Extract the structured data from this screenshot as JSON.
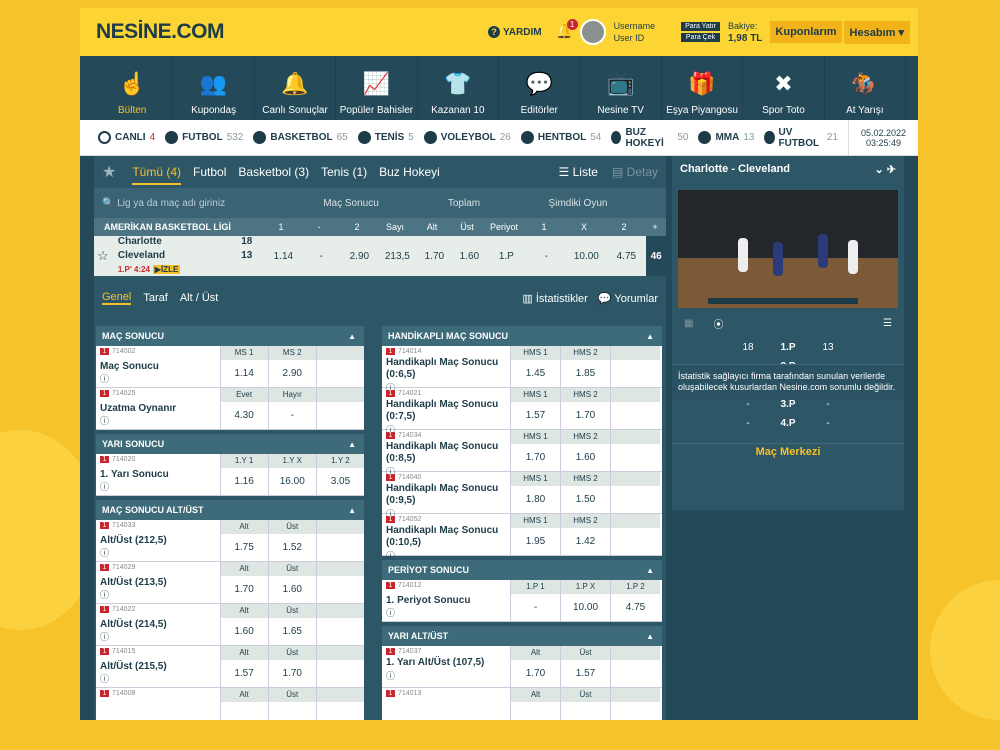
{
  "header": {
    "logo": "NESİNE.COM",
    "help": "YARDIM",
    "notif_count": "1",
    "username": "Username",
    "user_id": "User ID",
    "deposit": "Para Yatır",
    "withdraw": "Para Çek",
    "balance_label": "Bakiye:",
    "balance": "1,98 TL",
    "coupons": "Kuponlarım",
    "account": "Hesabım"
  },
  "nav": [
    "Bülten",
    "Kupondaş",
    "Canlı Sonuçlar",
    "Popüler Bahisler",
    "Kazanan 10",
    "Editörler",
    "Nesine TV",
    "Eşya Piyangosu",
    "Spor Toto",
    "At Yarışı"
  ],
  "sports": [
    {
      "label": "CANLI",
      "count": "4"
    },
    {
      "label": "FUTBOL",
      "count": "532"
    },
    {
      "label": "BASKETBOL",
      "count": "65"
    },
    {
      "label": "TENİS",
      "count": "5"
    },
    {
      "label": "VOLEYBOL",
      "count": "26"
    },
    {
      "label": "HENTBOL",
      "count": "54"
    },
    {
      "label": "BUZ HOKEYİ",
      "count": "50"
    },
    {
      "label": "MMA",
      "count": "13"
    },
    {
      "label": "UV FUTBOL",
      "count": "21"
    }
  ],
  "date": "05.02.2022",
  "time": "03:25:49",
  "filters": [
    "Tümü (4)",
    "Futbol",
    "Basketbol (3)",
    "Tenis (1)",
    "Buz Hokeyi"
  ],
  "view": {
    "list": "Liste",
    "detail": "Detay"
  },
  "search_placeholder": "Lig ya da maç adı giriniz",
  "col_groups": [
    "Maç Sonucu",
    "Toplam",
    "Şimdiki Oyun"
  ],
  "league": "AMERİKAN BASKETBOL LİGİ",
  "league_cols": [
    "1",
    "-",
    "2",
    "Sayı",
    "Alt",
    "Üst",
    "Periyot",
    "1",
    "X",
    "2",
    "+"
  ],
  "match": {
    "home": "Charlotte",
    "away": "Cleveland",
    "hs": "18",
    "as": "13",
    "live": "1.P' 4:24",
    "watch": "İZLE",
    "odds": [
      "1.14",
      "-",
      "2.90",
      "213,5",
      "1.70",
      "1.60",
      "1.P",
      "-",
      "10.00",
      "4.75"
    ],
    "more": "46"
  },
  "subtabs": [
    "Genel",
    "Taraf",
    "Alt / Üst"
  ],
  "stats": "İstatistikler",
  "comments": "Yorumlar",
  "left_markets": [
    {
      "title": "MAÇ SONUCU",
      "rows": [
        {
          "code": "714002",
          "name": "Maç Sonucu",
          "h": [
            "MS 1",
            "MS 2",
            ""
          ],
          "v": [
            "1.14",
            "2.90",
            ""
          ]
        },
        {
          "code": "714025",
          "name": "Uzatma Oynanır",
          "h": [
            "Evet",
            "Hayır",
            ""
          ],
          "v": [
            "4.30",
            "-",
            ""
          ]
        }
      ]
    },
    {
      "title": "YARI SONUCU",
      "rows": [
        {
          "code": "714020",
          "name": "1. Yarı Sonucu",
          "h": [
            "1.Y 1",
            "1.Y X",
            "1.Y 2"
          ],
          "v": [
            "1.16",
            "16.00",
            "3.05"
          ]
        }
      ]
    },
    {
      "title": "MAÇ SONUCU ALT/ÜST",
      "rows": [
        {
          "code": "714033",
          "name": "Alt/Üst (212,5)",
          "h": [
            "Alt",
            "Üst",
            ""
          ],
          "v": [
            "1.75",
            "1.52",
            ""
          ]
        },
        {
          "code": "714029",
          "name": "Alt/Üst (213,5)",
          "h": [
            "Alt",
            "Üst",
            ""
          ],
          "v": [
            "1.70",
            "1.60",
            ""
          ]
        },
        {
          "code": "714022",
          "name": "Alt/Üst (214,5)",
          "h": [
            "Alt",
            "Üst",
            ""
          ],
          "v": [
            "1.60",
            "1.65",
            ""
          ]
        },
        {
          "code": "714015",
          "name": "Alt/Üst (215,5)",
          "h": [
            "Alt",
            "Üst",
            ""
          ],
          "v": [
            "1.57",
            "1.70",
            ""
          ]
        },
        {
          "code": "714008",
          "name": "",
          "h": [
            "Alt",
            "Üst",
            ""
          ],
          "v": [
            "",
            "",
            ""
          ]
        }
      ]
    }
  ],
  "right_markets": [
    {
      "title": "HANDİKAPLI MAÇ SONUCU",
      "rows": [
        {
          "code": "714014",
          "name": "Handikaplı Maç Sonucu (0:6,5)",
          "h": [
            "HMS 1",
            "HMS 2",
            ""
          ],
          "v": [
            "1.45",
            "1.85",
            ""
          ]
        },
        {
          "code": "714021",
          "name": "Handikaplı Maç Sonucu (0:7,5)",
          "h": [
            "HMS 1",
            "HMS 2",
            ""
          ],
          "v": [
            "1.57",
            "1.70",
            ""
          ]
        },
        {
          "code": "714034",
          "name": "Handikaplı Maç Sonucu (0:8,5)",
          "h": [
            "HMS 1",
            "HMS 2",
            ""
          ],
          "v": [
            "1.70",
            "1.60",
            ""
          ]
        },
        {
          "code": "714040",
          "name": "Handikaplı Maç Sonucu (0:9,5)",
          "h": [
            "HMS 1",
            "HMS 2",
            ""
          ],
          "v": [
            "1.80",
            "1.50",
            ""
          ]
        },
        {
          "code": "714052",
          "name": "Handikaplı Maç Sonucu (0:10,5)",
          "h": [
            "HMS 1",
            "HMS 2",
            ""
          ],
          "v": [
            "1.95",
            "1.42",
            ""
          ]
        }
      ]
    },
    {
      "title": "PERİYOT SONUCU",
      "rows": [
        {
          "code": "714012",
          "name": "1. Periyot Sonucu",
          "h": [
            "1.P 1",
            "1.P X",
            "1.P 2"
          ],
          "v": [
            "-",
            "10.00",
            "4.75"
          ]
        }
      ]
    },
    {
      "title": "YARI ALT/ÜST",
      "rows": [
        {
          "code": "714037",
          "name": "1. Yarı Alt/Üst (107,5)",
          "h": [
            "Alt",
            "Üst",
            ""
          ],
          "v": [
            "1.70",
            "1.57",
            ""
          ]
        },
        {
          "code": "714013",
          "name": "",
          "h": [
            "Alt",
            "Üst",
            ""
          ],
          "v": [
            "",
            "",
            ""
          ]
        }
      ]
    }
  ],
  "panel": {
    "title": "Charlotte - Cleveland",
    "home_score": "18",
    "away_score": "13",
    "periods": [
      "1.P",
      "2.P",
      "İY",
      "3.P",
      "4.P"
    ],
    "dash": "-",
    "center": "Maç Merkezi",
    "disclaimer": "İstatistik sağlayıcı firma tarafından sunulan verilerde oluşabilecek kusurlardan Nesine.com sorumlu değildir."
  }
}
